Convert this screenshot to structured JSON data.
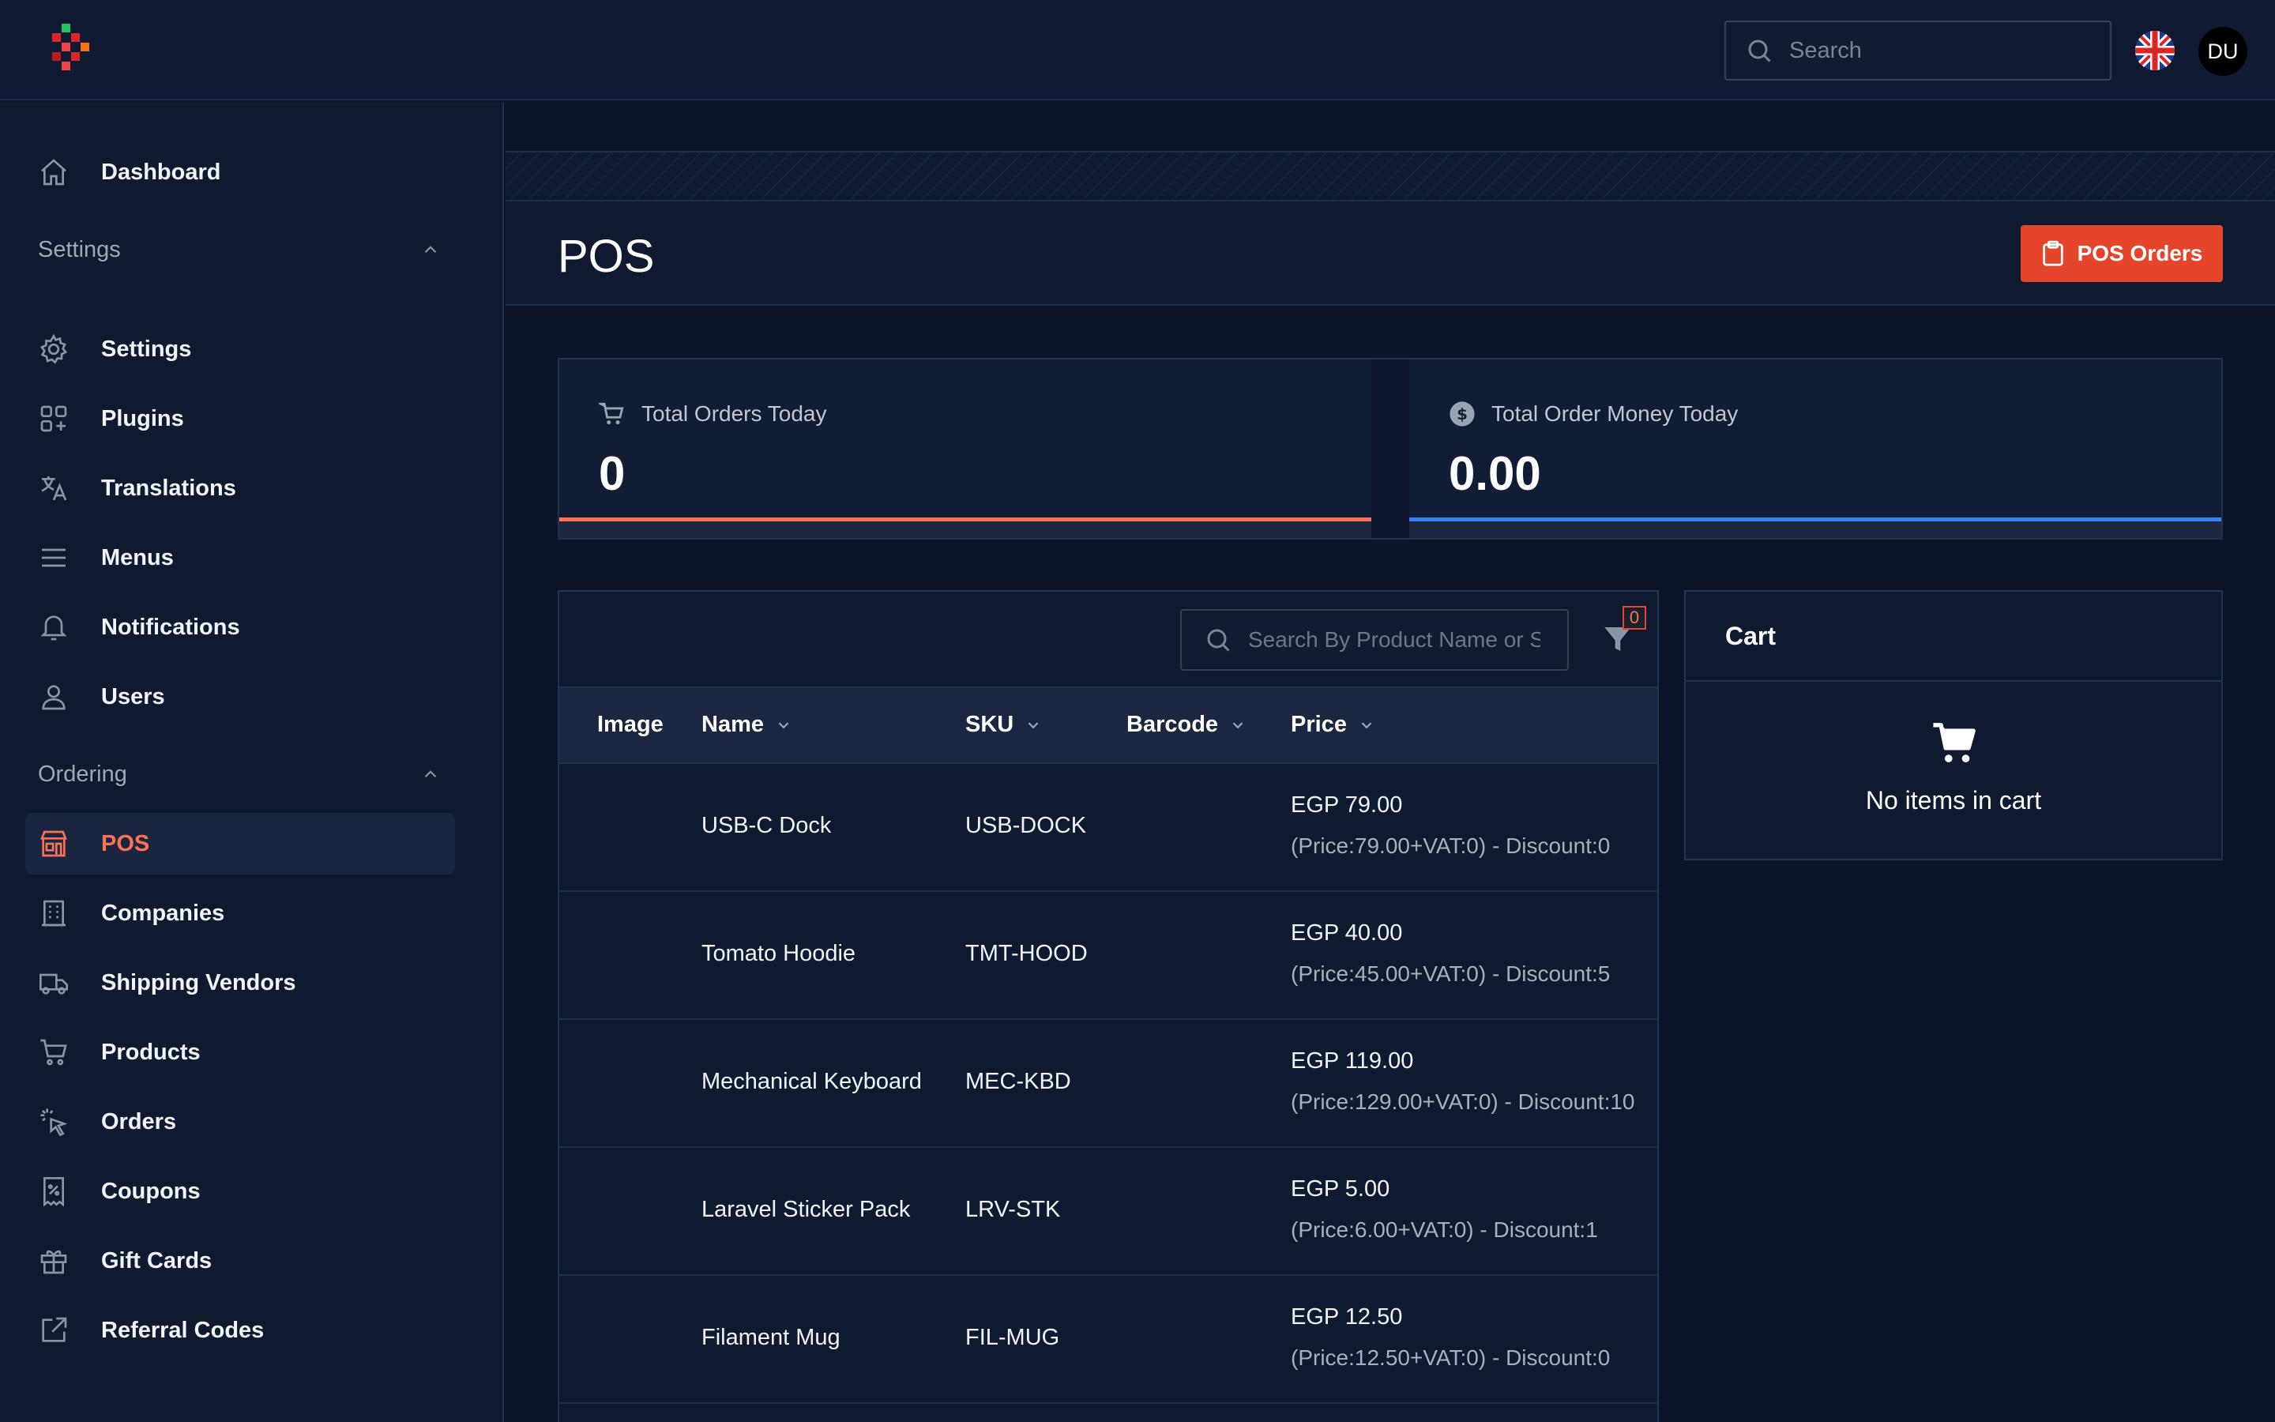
{
  "topbar": {
    "search_placeholder": "Search",
    "avatar_initials": "DU"
  },
  "sidebar": {
    "dashboard": "Dashboard",
    "groups": [
      {
        "label": "Settings",
        "items": [
          "Settings",
          "Plugins",
          "Translations",
          "Menus",
          "Notifications",
          "Users"
        ]
      },
      {
        "label": "Ordering",
        "items": [
          "POS",
          "Companies",
          "Shipping Vendors",
          "Products",
          "Orders",
          "Coupons",
          "Gift Cards",
          "Referral Codes"
        ]
      }
    ],
    "active_item": "POS"
  },
  "page": {
    "title": "POS",
    "pos_orders_button": "POS Orders"
  },
  "stats": [
    {
      "label": "Total Orders Today",
      "value": "0",
      "accent": "#f97354",
      "icon": "cart-icon"
    },
    {
      "label": "Total Order Money Today",
      "value": "0.00",
      "accent": "#3b82f6",
      "icon": "dollar-icon"
    }
  ],
  "products": {
    "search_placeholder": "Search By Product Name or SKU",
    "filter_count": "0",
    "columns": [
      "Image",
      "Name",
      "SKU",
      "Barcode",
      "Price"
    ],
    "rows": [
      {
        "name": "USB-C Dock",
        "sku": "USB-DOCK",
        "barcode": "",
        "price": "EGP 79.00",
        "detail": "(Price:79.00+VAT:0) - Discount:0"
      },
      {
        "name": "Tomato Hoodie",
        "sku": "TMT-HOOD",
        "barcode": "",
        "price": "EGP 40.00",
        "detail": "(Price:45.00+VAT:0) - Discount:5"
      },
      {
        "name": "Mechanical Keyboard",
        "sku": "MEC-KBD",
        "barcode": "",
        "price": "EGP 119.00",
        "detail": "(Price:129.00+VAT:0) - Discount:10"
      },
      {
        "name": "Laravel Sticker Pack",
        "sku": "LRV-STK",
        "barcode": "",
        "price": "EGP 5.00",
        "detail": "(Price:6.00+VAT:0) - Discount:1"
      },
      {
        "name": "Filament Mug",
        "sku": "FIL-MUG",
        "barcode": "",
        "price": "EGP 12.50",
        "detail": "(Price:12.50+VAT:0) - Discount:0"
      }
    ]
  },
  "cart": {
    "title": "Cart",
    "empty_text": "No items in cart"
  },
  "colors": {
    "accent": "#e4452b",
    "background": "#0b1326"
  }
}
